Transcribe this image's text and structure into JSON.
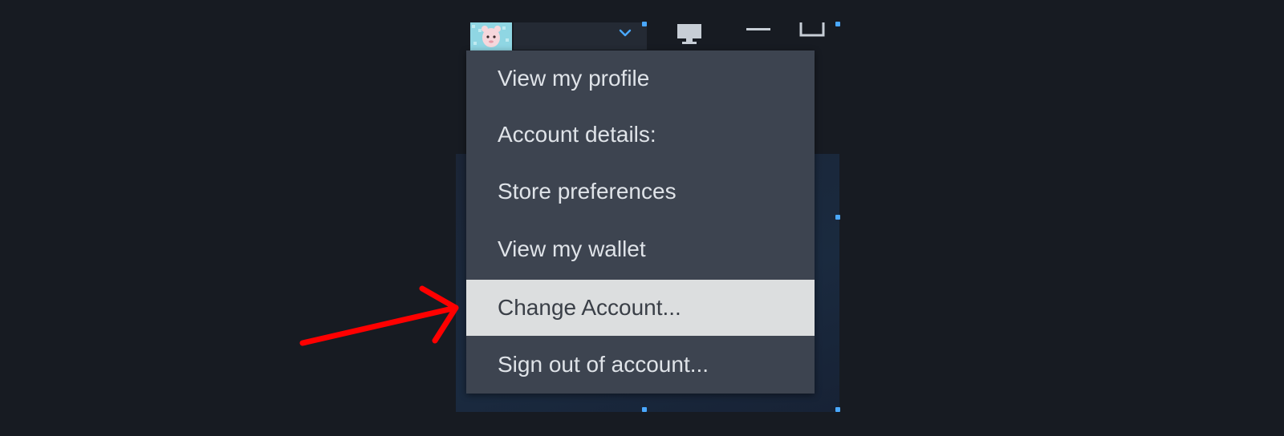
{
  "menu": {
    "items": [
      {
        "label": "View my profile"
      },
      {
        "label": "Account details:"
      },
      {
        "label": "Store preferences"
      },
      {
        "label": "View my wallet"
      },
      {
        "label": "Change Account..."
      },
      {
        "label": "Sign out of account..."
      }
    ],
    "highlighted_index": 4
  },
  "topbar": {
    "account_dropdown_icon": "chevron-down-icon",
    "icons": [
      "monitor-icon",
      "minimize-icon",
      "maximize-icon"
    ]
  },
  "annotation": {
    "type": "red-arrow",
    "color": "#ff0000",
    "points_to": "Change Account..."
  },
  "colors": {
    "background": "#171b22",
    "menu_bg": "#3d4450",
    "menu_text": "#dfe3e8",
    "highlight_bg": "#dcdedf",
    "highlight_text": "#3a3f47",
    "accent": "#4aa8ff"
  }
}
